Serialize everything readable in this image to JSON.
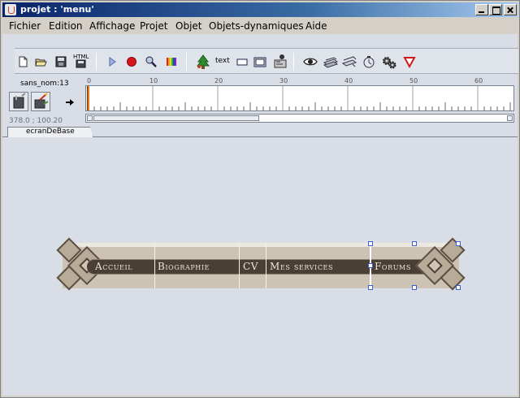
{
  "window": {
    "title": "projet : 'menu'"
  },
  "menubar": [
    "Fichier",
    "Edition",
    "Affichage",
    "Projet",
    "Objet",
    "Objets-dynamiques",
    "Aide"
  ],
  "toolbar": {
    "text_label": "text",
    "html_label": "HTML"
  },
  "timeline": {
    "scene_name": "sans_nom:13",
    "coordinates": "378.0 ; 100.20",
    "ruler_labels": [
      "0",
      "10",
      "20",
      "30",
      "40",
      "50",
      "60"
    ]
  },
  "tabs": {
    "active": "ecranDeBase"
  },
  "banner": {
    "items": [
      "Accueil",
      "Biographie",
      "CV",
      "Mes services",
      "Forums"
    ]
  },
  "colors": {
    "titlebar_start": "#0a246a",
    "workarea": "#d8dde6",
    "banner_bar": "#4a3f35",
    "banner_bg": "#cdc3b4"
  },
  "icons": [
    "new-file-icon",
    "open-folder-icon",
    "save-icon",
    "html-export-icon",
    "play-icon",
    "record-icon",
    "zoom-icon",
    "color-palette-icon",
    "tree-icon",
    "text-tool-icon",
    "rectangle-tool-icon",
    "frame-tool-icon",
    "object-tool-icon",
    "eye-icon",
    "layers-icon",
    "layers-alt-icon",
    "timer-icon",
    "gears-icon",
    "filter-icon"
  ]
}
